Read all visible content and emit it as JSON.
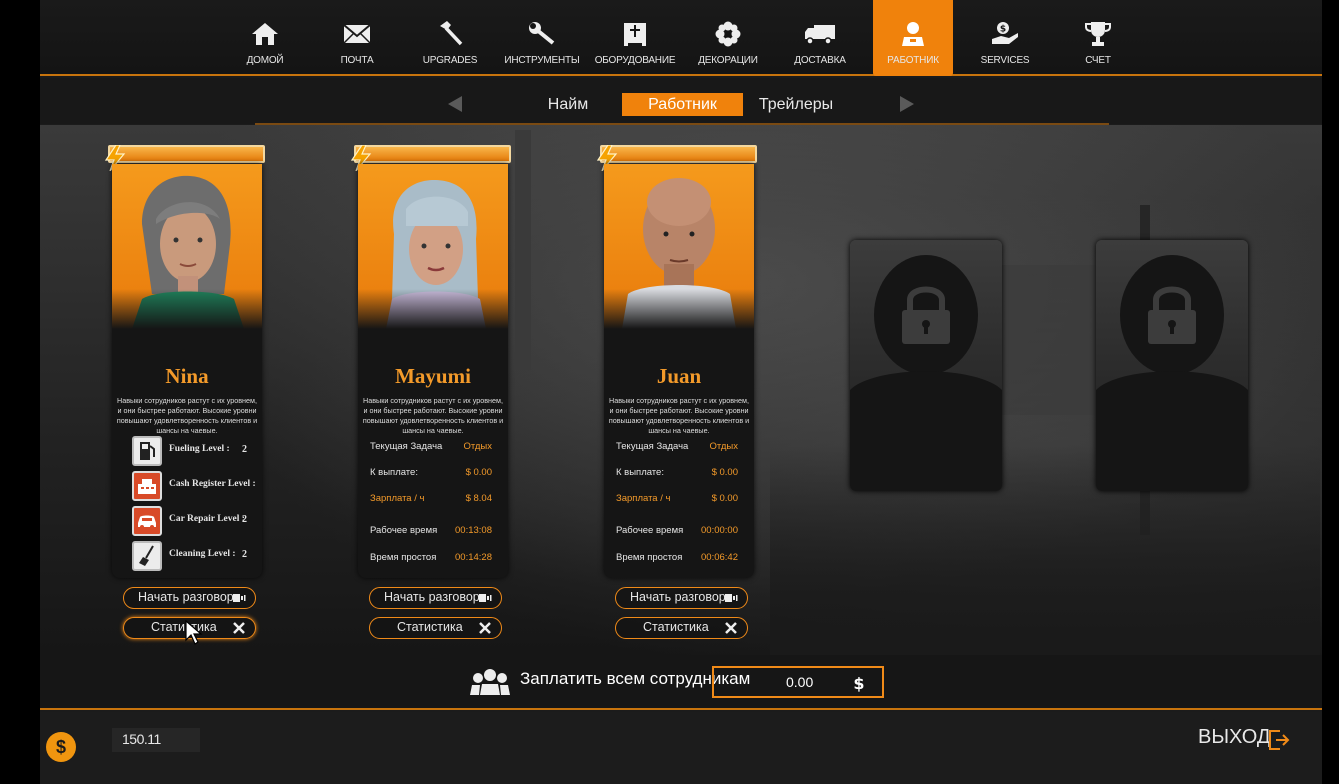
{
  "nav": {
    "items": [
      {
        "label": "ДОМОЙ",
        "icon": "home-icon"
      },
      {
        "label": "ПОЧТА",
        "icon": "mail-icon"
      },
      {
        "label": "UPGRADES",
        "icon": "hammer-icon"
      },
      {
        "label": "ИНСТРУМЕНТЫ",
        "icon": "wrench-icon"
      },
      {
        "label": "ОБОРУДОВАНИЕ",
        "icon": "equipment-icon"
      },
      {
        "label": "ДЕКОРАЦИИ",
        "icon": "flower-icon"
      },
      {
        "label": "ДОСТАВКА",
        "icon": "truck-icon"
      },
      {
        "label": "РАБОТНИК",
        "icon": "worker-icon",
        "active": true
      },
      {
        "label": "SERVICES",
        "icon": "services-icon"
      },
      {
        "label": "СЧЕТ",
        "icon": "trophy-icon"
      }
    ]
  },
  "subtabs": {
    "items": [
      {
        "label": "Найм"
      },
      {
        "label": "Работник",
        "active": true
      },
      {
        "label": "Трейлеры"
      }
    ]
  },
  "workers": [
    {
      "name": "Nina",
      "description": "Навыки сотрудников растут с их уровнем, и они быстрее работают. Высокие уровни повышают удовлетворенность клиентов и шансы на чаевые.",
      "skills": [
        {
          "label": "Fueling Level :",
          "value": "2",
          "icon": "fuel-pump-icon"
        },
        {
          "label": "Cash Register Level :",
          "value": "6",
          "icon": "cash-register-icon"
        },
        {
          "label": "Car Repair Level :",
          "value": "2",
          "icon": "car-icon"
        },
        {
          "label": "Cleaning Level :",
          "value": "2",
          "icon": "broom-icon"
        }
      ],
      "talk_label": "Начать разговор",
      "stats_label": "Статистика"
    },
    {
      "name": "Mayumi",
      "description": "Навыки сотрудников растут с их уровнем, и они быстрее работают. Высокие уровни повышают удовлетворенность клиентов и шансы на чаевые.",
      "stats": [
        {
          "label": "Текущая Задача",
          "value": "Отдых"
        },
        {
          "label": "К выплате:",
          "value": "$ 0.00"
        },
        {
          "label": "Зарплата / ч",
          "value": "$ 8.04"
        },
        {
          "label": "Рабочее время",
          "value": "00:13:08"
        },
        {
          "label": "Время простоя",
          "value": "00:14:28"
        }
      ],
      "talk_label": "Начать разговор",
      "stats_label": "Статистика"
    },
    {
      "name": "Juan",
      "description": "Навыки сотрудников растут с их уровнем, и они быстрее работают. Высокие уровни повышают удовлетворенность клиентов и шансы на чаевые.",
      "stats": [
        {
          "label": "Текущая Задача",
          "value": "Отдых"
        },
        {
          "label": "К выплате:",
          "value": "$ 0.00"
        },
        {
          "label": "Зарплата / ч",
          "value": "$ 0.00"
        },
        {
          "label": "Рабочее время",
          "value": "00:00:00"
        },
        {
          "label": "Время простоя",
          "value": "00:06:42"
        }
      ],
      "talk_label": "Начать разговор",
      "stats_label": "Статистика"
    }
  ],
  "locked_slots": 2,
  "pay_all": {
    "label": "Заплатить всем сотрудникам",
    "value": "0.00"
  },
  "footer": {
    "money": "150.11",
    "exit_label": "ВЫХОД"
  },
  "colors": {
    "accent": "#f0820c",
    "name_text": "#f39a2a"
  }
}
